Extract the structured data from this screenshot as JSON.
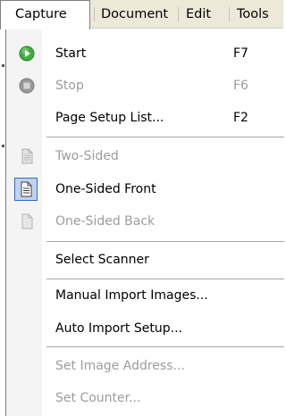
{
  "menubar": {
    "items": [
      "Capture",
      "Document",
      "Edit",
      "Tools"
    ]
  },
  "menu": {
    "items": [
      {
        "label": "Start",
        "shortcut": "F7",
        "icon": "play-icon"
      },
      {
        "label": "Stop",
        "shortcut": "F6",
        "icon": "stop-icon"
      },
      {
        "label": "Page Setup List...",
        "shortcut": "F2"
      },
      {
        "label": "Two-Sided",
        "icon": "two-sided-page-icon"
      },
      {
        "label": "One-Sided Front",
        "icon": "one-sided-front-page-icon"
      },
      {
        "label": "One-Sided Back",
        "icon": "one-sided-back-page-icon"
      },
      {
        "label": "Select Scanner"
      },
      {
        "label": "Manual Import Images..."
      },
      {
        "label": "Auto Import Setup..."
      },
      {
        "label": "Set Image Address..."
      },
      {
        "label": "Set Counter..."
      }
    ]
  },
  "colors": {
    "menubar_bg": "#ece9d8",
    "disabled_text": "#9c9c9c",
    "checked_highlight": "#c1d2ee",
    "play_green": "#3fae3f"
  }
}
